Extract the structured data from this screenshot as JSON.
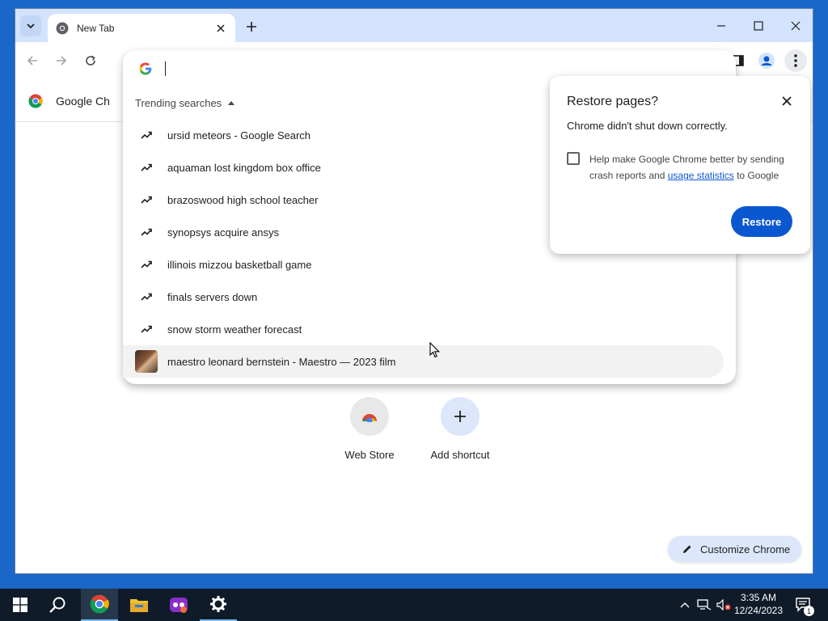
{
  "browser": {
    "tab_title": "New Tab",
    "bookmark_label": "Google Ch"
  },
  "omnibox": {
    "value": "",
    "trending_header": "Trending searches",
    "suggestions": [
      {
        "text": "ursid meteors - Google Search",
        "icon": "trending-icon"
      },
      {
        "text": "aquaman lost kingdom box office",
        "icon": "trending-icon"
      },
      {
        "text": "brazoswood high school teacher",
        "icon": "trending-icon"
      },
      {
        "text": "synopsys acquire ansys",
        "icon": "trending-icon"
      },
      {
        "text": "illinois mizzou basketball game",
        "icon": "trending-icon"
      },
      {
        "text": "finals servers down",
        "icon": "trending-icon"
      },
      {
        "text": "snow storm weather forecast",
        "icon": "trending-icon"
      },
      {
        "text": "maestro leonard bernstein - Maestro — 2023 film",
        "icon": "thumbnail"
      }
    ]
  },
  "restore_dialog": {
    "title": "Restore pages?",
    "message": "Chrome didn't shut down correctly.",
    "checkbox_text_1": "Help make Google Chrome better by sending crash reports and ",
    "checkbox_link": "usage statistics",
    "checkbox_text_2": " to Google",
    "checkbox_checked": false,
    "button_label": "Restore"
  },
  "shortcuts": [
    {
      "label": "Web Store",
      "icon": "webstore-icon"
    },
    {
      "label": "Add shortcut",
      "icon": "plus-icon"
    }
  ],
  "customize_label": "Customize Chrome",
  "taskbar": {
    "time": "3:35 AM",
    "date": "12/24/2023",
    "notification_count": "1"
  },
  "colors": {
    "accent": "#0b57d0",
    "tabstrip": "#d3e3fd",
    "taskbar": "#101b29",
    "desktop": "#1a66c9"
  }
}
